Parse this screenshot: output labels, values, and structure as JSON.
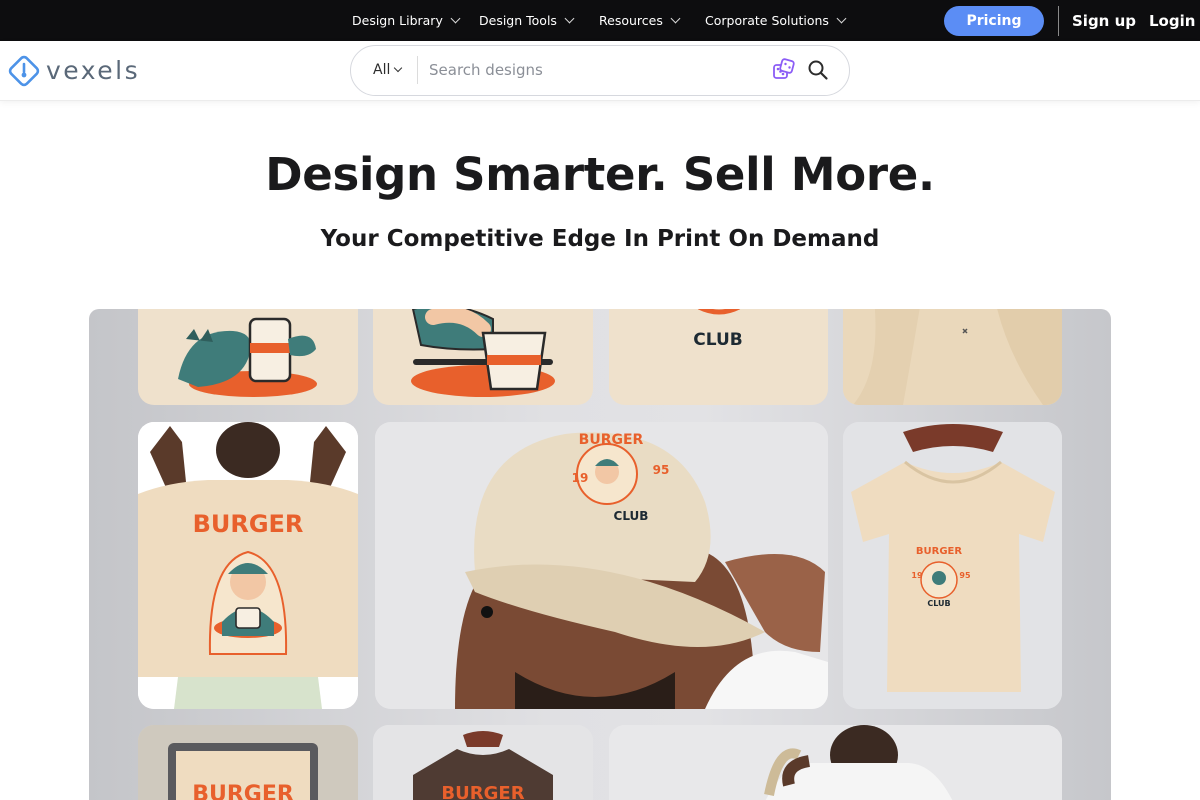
{
  "topbar": {
    "nav": [
      {
        "label": "Design Library"
      },
      {
        "label": "Design Tools"
      },
      {
        "label": "Resources"
      },
      {
        "label": "Corporate Solutions"
      }
    ],
    "pricing_label": "Pricing",
    "signup_label": "Sign up",
    "login_label": "Login"
  },
  "header": {
    "logo_text": "vexels",
    "search": {
      "category": "All",
      "placeholder": "Search designs"
    }
  },
  "hero": {
    "title": "Design Smarter. Sell More.",
    "subtitle": "Your Competitive Edge In Print On Demand"
  },
  "showcase": {
    "burger_word": "BURGER",
    "club_word": "CLUB",
    "year_left": "19",
    "year_right": "95"
  },
  "colors": {
    "topbar_bg": "#0d0d0f",
    "pricing_bg": "#5b8df5",
    "accent_orange": "#e8602c",
    "teal": "#3f7c7a",
    "beige": "#efe1cc"
  }
}
